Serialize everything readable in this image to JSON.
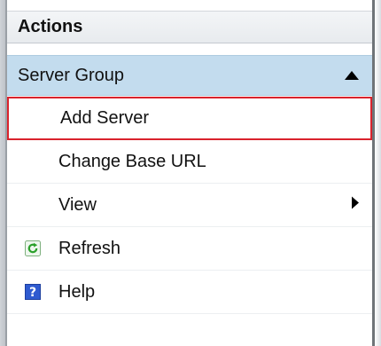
{
  "pane": {
    "title": "Actions"
  },
  "group": {
    "label": "Server Group",
    "collapse_icon": "triangle-up-icon"
  },
  "items": [
    {
      "label": "Add Server",
      "selected": true
    },
    {
      "label": "Change Base URL"
    },
    {
      "label": "View",
      "submenu_icon": "triangle-right-icon"
    },
    {
      "label": "Refresh",
      "icon": "refresh-icon"
    },
    {
      "label": "Help",
      "icon": "help-icon"
    }
  ],
  "colors": {
    "group_header_bg": "#c3dcee",
    "selection_border": "#d9232d",
    "help_icon_bg": "#2f5bd0",
    "refresh_icon": "#2aa02a"
  }
}
